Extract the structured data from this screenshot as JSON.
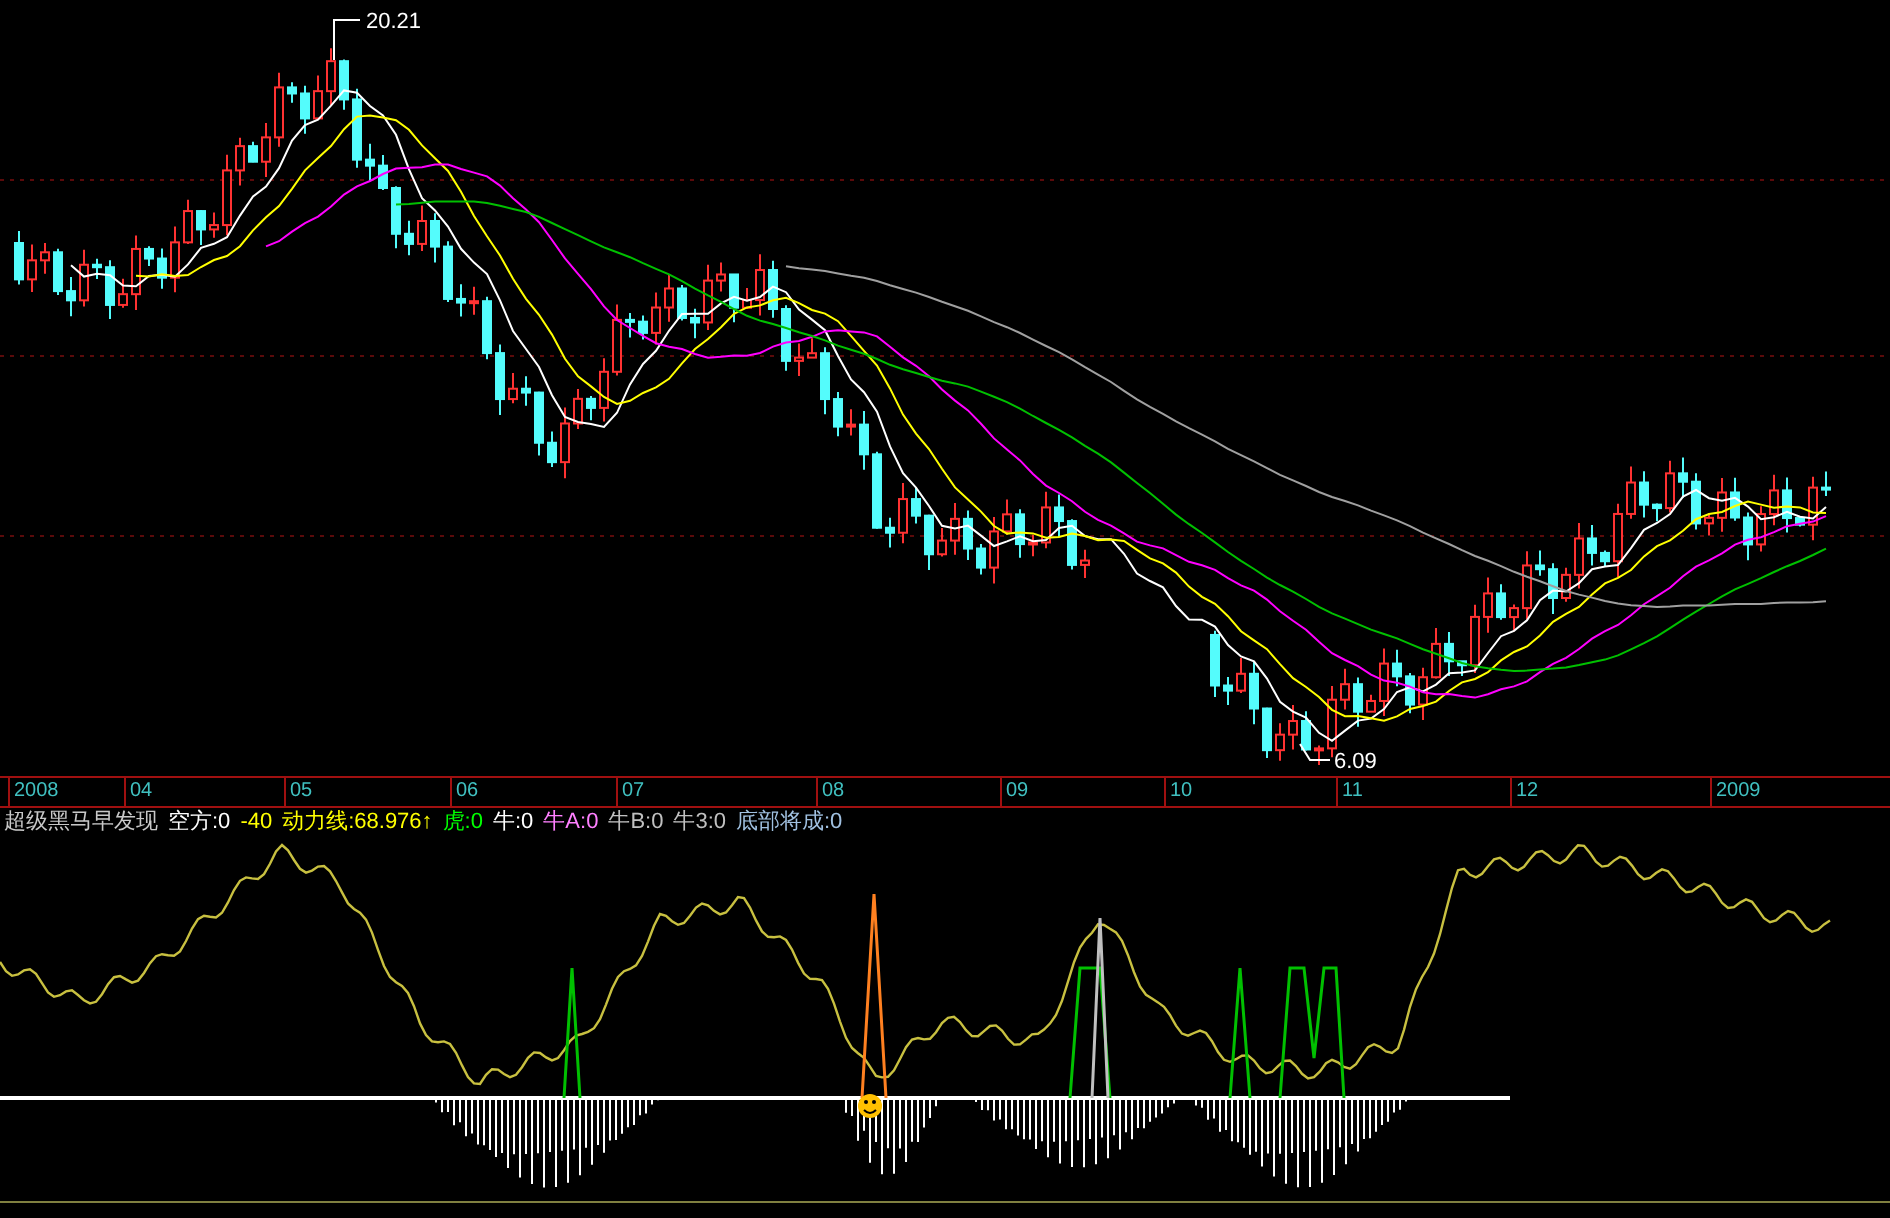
{
  "price_chart": {
    "high_label": "20.21",
    "low_label": "6.09"
  },
  "time_axis": {
    "labels": [
      "2008",
      "04",
      "05",
      "06",
      "07",
      "08",
      "09",
      "10",
      "11",
      "12",
      "2009"
    ]
  },
  "indicator": {
    "title": "超级黑马早发现",
    "readouts": [
      {
        "text": "空方:0",
        "color": "#ffffff"
      },
      {
        "text": "-40",
        "color": "#ffff00"
      },
      {
        "text": "动力线:68.976↑",
        "color": "#ffff00"
      },
      {
        "text": "虎:0",
        "color": "#00ff00"
      },
      {
        "text": "牛:0",
        "color": "#ffffff"
      },
      {
        "text": "牛A:0",
        "color": "#ff80ff"
      },
      {
        "text": "牛B:0",
        "color": "#c0c0c0"
      },
      {
        "text": "牛3:0",
        "color": "#c0c0c0"
      },
      {
        "text": "底部将成:0",
        "color": "#a0c0e0"
      }
    ]
  }
}
